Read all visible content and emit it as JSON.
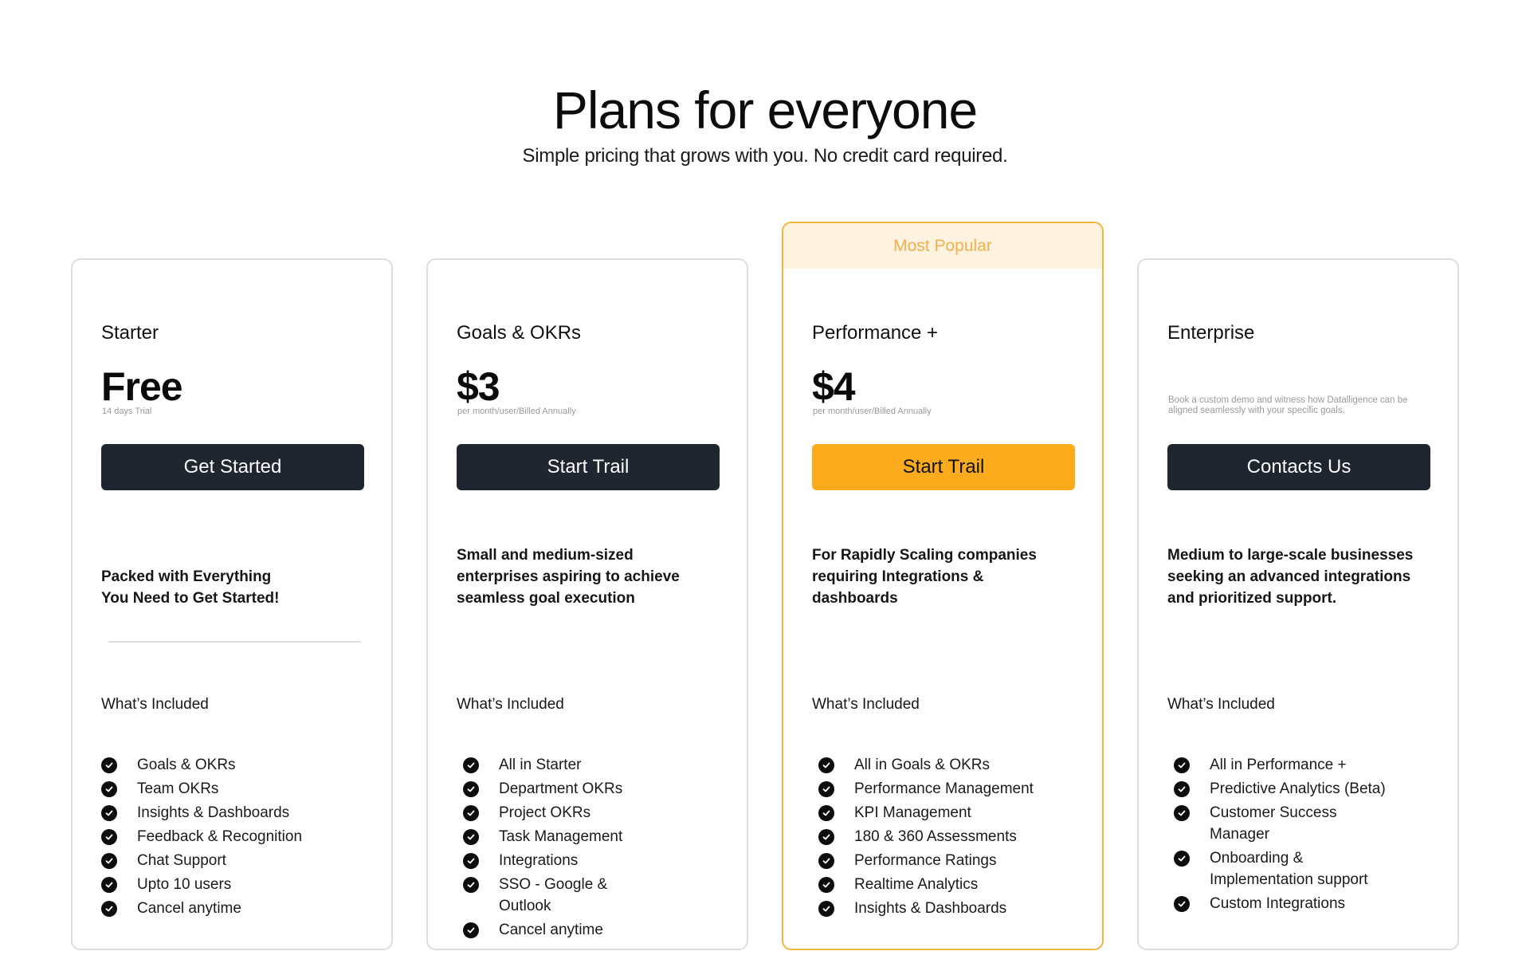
{
  "header": {
    "title": "Plans for everyone",
    "subtitle": "Simple pricing that grows with you. No credit card required."
  },
  "colors": {
    "accent": "#fbab1c",
    "popular_border": "#f3b53c",
    "badge_bg": "#fef2e1",
    "badge_text": "#f4b04a",
    "dark_button": "#1f262f"
  },
  "plans": [
    {
      "name": "Starter",
      "price": "Free",
      "price_note": "14 days Trial",
      "cta": "Get Started",
      "description": "Packed with Everything You Need to Get Started!",
      "included_title": "What’s Included",
      "features": [
        "Goals & OKRs",
        "Team OKRs",
        "Insights & Dashboards",
        "Feedback & Recognition",
        "Chat Support",
        "Upto 10 users",
        "Cancel anytime"
      ]
    },
    {
      "name": "Goals & OKRs",
      "price": "$3",
      "price_note": "per month/user/Billed Annually",
      "cta": "Start Trail",
      "description": "Small and medium-sized enterprises aspiring to achieve seamless goal execution",
      "included_title": "What’s Included",
      "features": [
        "All in Starter",
        "Department OKRs",
        "Project OKRs",
        "Task Management",
        "Integrations",
        "SSO - Google & Outlook",
        "Cancel anytime"
      ]
    },
    {
      "badge": "Most Popular",
      "name": "Performance +",
      "price": "$4",
      "price_note": "per month/user/Billed Annually",
      "cta": "Start Trail",
      "description": "For Rapidly Scaling companies requiring Integrations & dashboards",
      "included_title": "What’s Included",
      "features": [
        "All in Goals & OKRs",
        "Performance Management",
        "KPI Management",
        "180 & 360 Assessments",
        "Performance Ratings",
        "Realtime Analytics",
        "Insights & Dashboards"
      ]
    },
    {
      "name": "Enterprise",
      "price_note": "Book a custom demo and witness how Datalligence can be aligned seamlessly with your specific goals.",
      "cta": "Contacts Us",
      "description": "Medium to large-scale businesses seeking an advanced integrations and prioritized support.",
      "included_title": "What’s Included",
      "features": [
        "All in Performance +",
        "Predictive Analytics (Beta)",
        "Customer Success Manager",
        "Onboarding & Implementation support",
        "Custom Integrations"
      ]
    }
  ]
}
